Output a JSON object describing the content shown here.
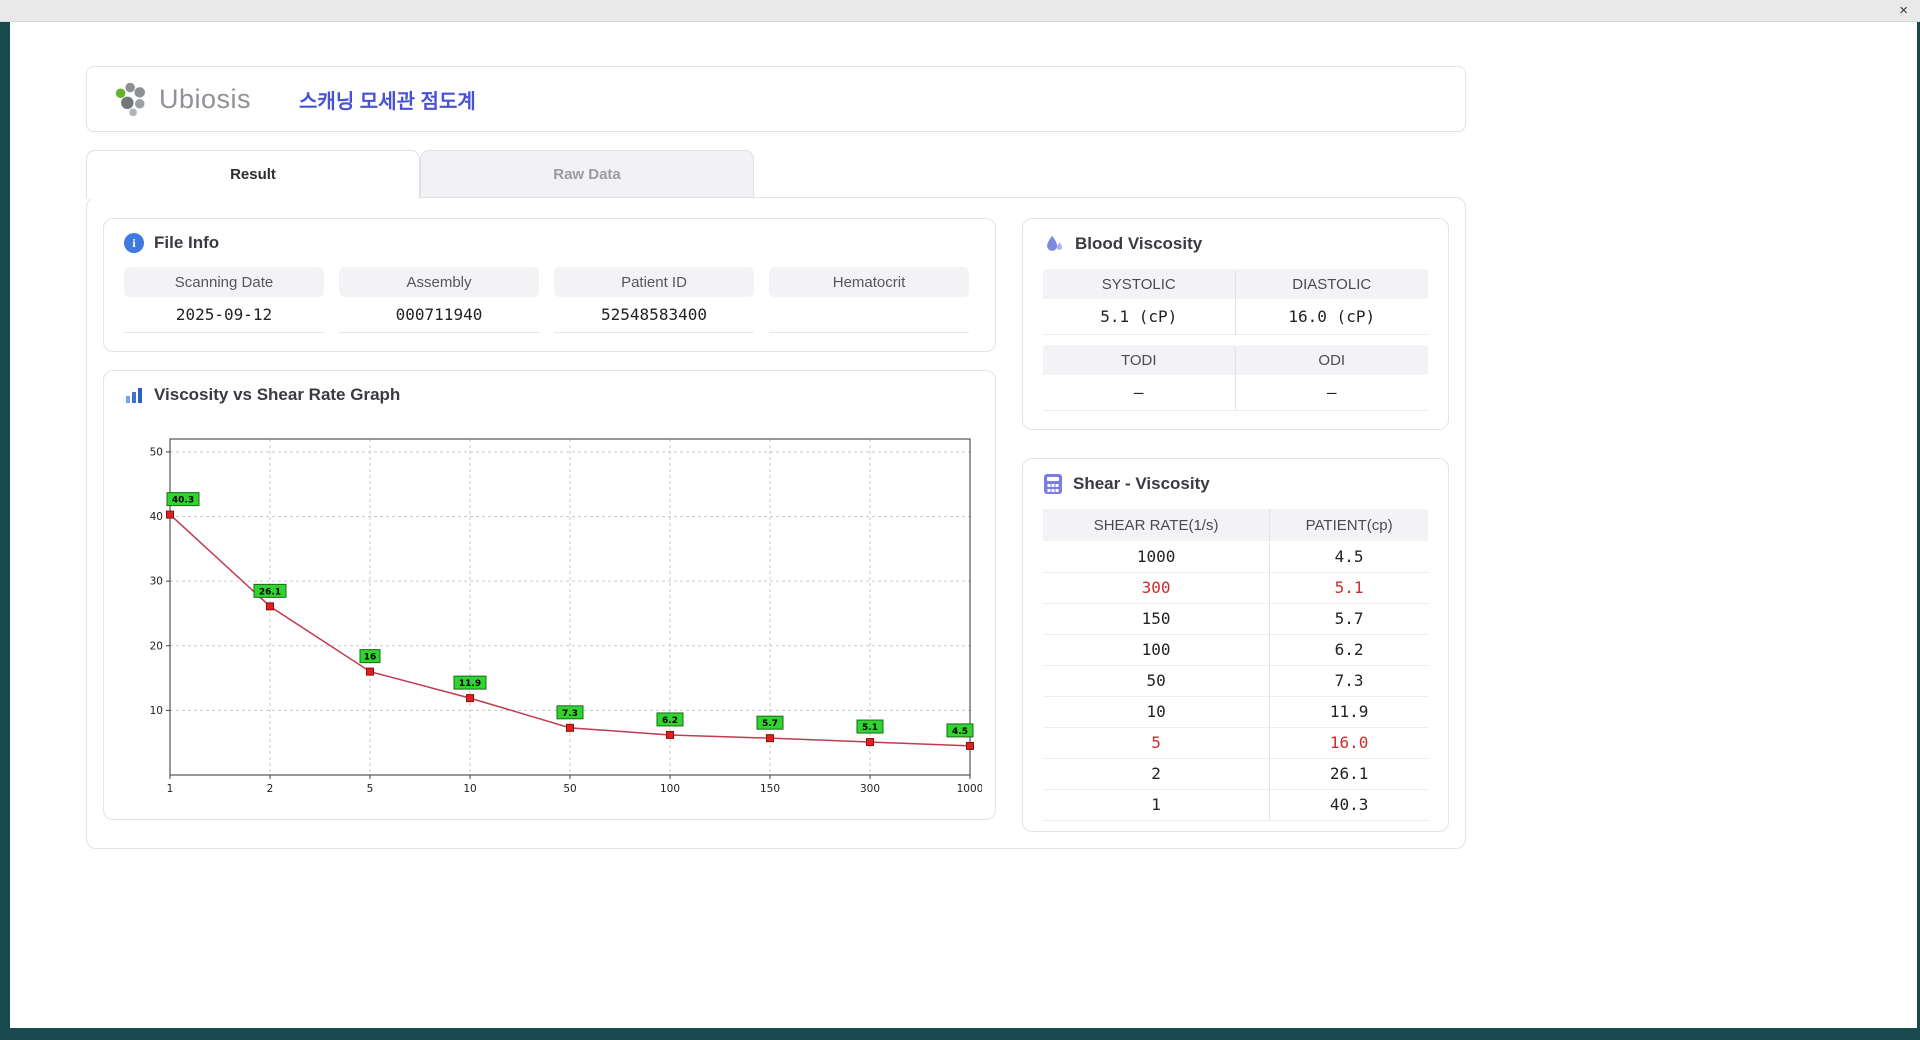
{
  "titlebar": {
    "close_label": "×"
  },
  "header": {
    "logo_text": "Ubiosis",
    "title": "스캐닝 모세관 점도계"
  },
  "tabs": [
    {
      "label": "Result"
    },
    {
      "label": "Raw Data"
    }
  ],
  "file_info": {
    "title": "File Info",
    "fields": [
      {
        "label": "Scanning Date",
        "value": "2025-09-12"
      },
      {
        "label": "Assembly",
        "value": "000711940"
      },
      {
        "label": "Patient ID",
        "value": "52548583400"
      },
      {
        "label": "Hematocrit",
        "value": ""
      }
    ]
  },
  "graph_section": {
    "title": "Viscosity vs Shear Rate Graph"
  },
  "blood_viscosity": {
    "title": "Blood Viscosity",
    "systolic_label": "SYSTOLIC",
    "diastolic_label": "DIASTOLIC",
    "systolic_value": "5.1 (cP)",
    "diastolic_value": "16.0 (cP)",
    "todi_label": "TODI",
    "odi_label": "ODI",
    "todi_value": "–",
    "odi_value": "–"
  },
  "shear_viscosity": {
    "title": "Shear - Viscosity",
    "columns": [
      "SHEAR RATE(1/s)",
      "PATIENT(cp)"
    ],
    "rows": [
      {
        "shear": "1000",
        "patient": "4.5",
        "highlight": false
      },
      {
        "shear": "300",
        "patient": "5.1",
        "highlight": true
      },
      {
        "shear": "150",
        "patient": "5.7",
        "highlight": false
      },
      {
        "shear": "100",
        "patient": "6.2",
        "highlight": false
      },
      {
        "shear": "50",
        "patient": "7.3",
        "highlight": false
      },
      {
        "shear": "10",
        "patient": "11.9",
        "highlight": false
      },
      {
        "shear": "5",
        "patient": "16.0",
        "highlight": true
      },
      {
        "shear": "2",
        "patient": "26.1",
        "highlight": false
      },
      {
        "shear": "1",
        "patient": "40.3",
        "highlight": false
      }
    ]
  },
  "chart_data": {
    "type": "line",
    "title": "Viscosity vs Shear Rate Graph",
    "x_ticks": [
      "1",
      "2",
      "5",
      "10",
      "50",
      "100",
      "150",
      "300",
      "1000"
    ],
    "x": [
      1,
      2,
      5,
      10,
      50,
      100,
      150,
      300,
      1000
    ],
    "values": [
      40.3,
      26.1,
      16,
      11.9,
      7.3,
      6.2,
      5.7,
      5.1,
      4.5
    ],
    "point_labels": [
      "40.3",
      "26.1",
      "16",
      "11.9",
      "7.3",
      "6.2",
      "5.7",
      "5.1",
      "4.5"
    ],
    "y_ticks": [
      10,
      20,
      30,
      40,
      50
    ],
    "ylim": [
      0,
      52
    ],
    "xlabel": "",
    "ylabel": "",
    "grid": true,
    "legend": false,
    "line_color": "#c43a50",
    "marker_color": "#e02020",
    "marker_border": "#8a0f0f",
    "label_bg": "#2fd42f",
    "label_border": "#1a6b1a"
  }
}
